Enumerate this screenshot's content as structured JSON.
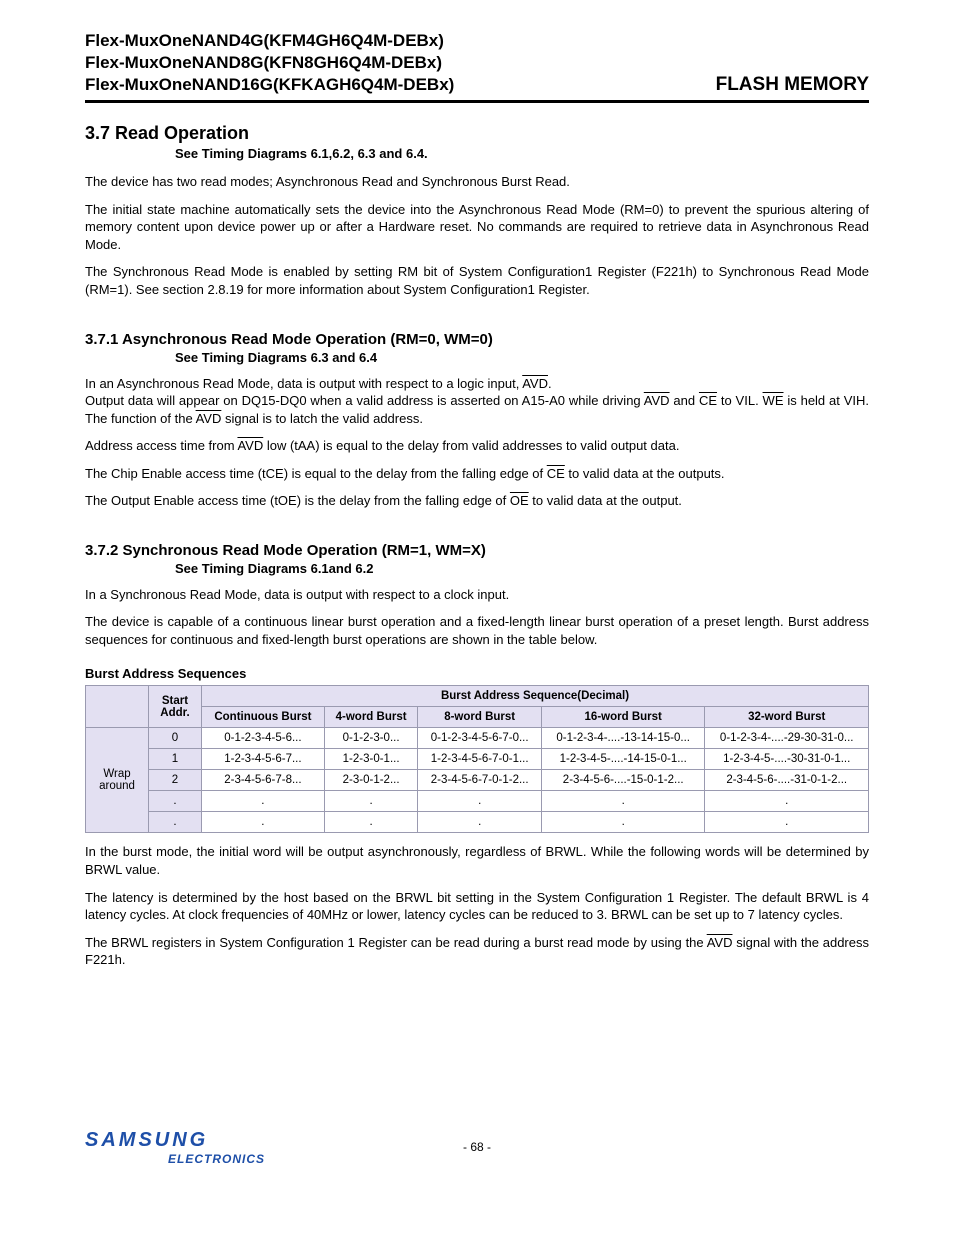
{
  "header": {
    "line1": "Flex-MuxOneNAND4G(KFM4GH6Q4M-DEBx)",
    "line2": "Flex-MuxOneNAND8G(KFN8GH6Q4M-DEBx)",
    "line3": "Flex-MuxOneNAND16G(KFKAGH6Q4M-DEBx)",
    "right": "FLASH MEMORY"
  },
  "s37": {
    "title": "3.7 Read Operation",
    "see": "See Timing Diagrams 6.1,6.2, 6.3 and 6.4.",
    "p1": "The device has two read modes; Asynchronous Read and Synchronous Burst Read.",
    "p2": "The initial state machine automatically sets the device into the Asynchronous Read Mode (RM=0) to prevent the spurious altering of memory content upon device power up or after a Hardware reset. No commands are required to retrieve data in Asynchronous Read Mode.",
    "p3": "The Synchronous Read Mode is enabled by setting RM bit of System Configuration1 Register (F221h) to Synchronous Read Mode (RM=1). See section 2.8.19 for more information about System Configuration1 Register."
  },
  "s371": {
    "title": "3.7.1 Asynchronous Read Mode Operation (RM=0, WM=0)",
    "see": "See Timing Diagrams 6.3 and 6.4",
    "p1a": "In an Asynchronous Read Mode, data is output with respect to a logic input, ",
    "p1b": ".",
    "p2a": "Output data will appear on DQ15-DQ0 when a valid address is asserted on A15-A0 while driving ",
    "p2b": " and ",
    "p2c": " to VIL. ",
    "p2d": " is held at VIH. The function of the ",
    "p2e": " signal is to latch the valid address.",
    "p3a": "Address access time from ",
    "p3b": " low (tAA) is equal to the delay from valid addresses to valid output data.",
    "p4a": "The Chip Enable access time (tCE) is equal to the delay from the falling edge of ",
    "p4b": " to valid data at the outputs.",
    "p5a": "The Output Enable access time (tOE) is the delay from the falling edge of ",
    "p5b": " to valid data at the output."
  },
  "s372": {
    "title": "3.7.2 Synchronous Read Mode Operation (RM=1, WM=X)",
    "see": "See Timing Diagrams 6.1and 6.2",
    "p1": "In a Synchronous Read Mode, data is output with respect to a clock input.",
    "p2": "The device is capable of a continuous linear burst operation and a fixed-length linear burst operation of a preset length. Burst address sequences for continuous and fixed-length burst operations are shown in the table below.",
    "tableCaption": "Burst Address Sequences",
    "tbl": {
      "hSpan": "Burst Address Sequence(Decimal)",
      "hStart": "Start Addr.",
      "cols": [
        "Continuous Burst",
        "4-word Burst",
        "8-word Burst",
        "16-word Burst",
        "32-word Burst"
      ],
      "rowLabel": "Wrap around",
      "rows": [
        {
          "addr": "0",
          "c": [
            "0-1-2-3-4-5-6...",
            "0-1-2-3-0...",
            "0-1-2-3-4-5-6-7-0...",
            "0-1-2-3-4-....-13-14-15-0...",
            "0-1-2-3-4-....-29-30-31-0..."
          ]
        },
        {
          "addr": "1",
          "c": [
            "1-2-3-4-5-6-7...",
            "1-2-3-0-1...",
            "1-2-3-4-5-6-7-0-1...",
            "1-2-3-4-5-....-14-15-0-1...",
            "1-2-3-4-5-....-30-31-0-1..."
          ]
        },
        {
          "addr": "2",
          "c": [
            "2-3-4-5-6-7-8...",
            "2-3-0-1-2...",
            "2-3-4-5-6-7-0-1-2...",
            "2-3-4-5-6-....-15-0-1-2...",
            "2-3-4-5-6-....-31-0-1-2..."
          ]
        },
        {
          "addr": ".",
          "c": [
            ".",
            ".",
            ".",
            ".",
            "."
          ]
        },
        {
          "addr": ".",
          "c": [
            ".",
            ".",
            ".",
            ".",
            "."
          ]
        }
      ]
    },
    "p3": "In the burst mode, the initial word will be output asynchronously, regardless of BRWL. While the following words will be determined by BRWL value.",
    "p4": "The latency is determined by the host based on the BRWL bit setting in the System Configuration 1 Register. The default BRWL is 4 latency cycles. At clock frequencies of 40MHz or lower, latency cycles can be reduced to 3. BRWL can be set up to 7 latency cycles.",
    "p5a": "The BRWL registers in System Configuration 1 Register can be read during a burst read mode by using the ",
    "p5b": " signal with the  address F221h."
  },
  "signals": {
    "avd": "AVD",
    "ce": "CE",
    "we": "WE",
    "oe": "OE"
  },
  "footer": {
    "pagenum": "- 68 -",
    "logoMain": "SAMSUNG",
    "logoSub": "ELECTRONICS"
  }
}
